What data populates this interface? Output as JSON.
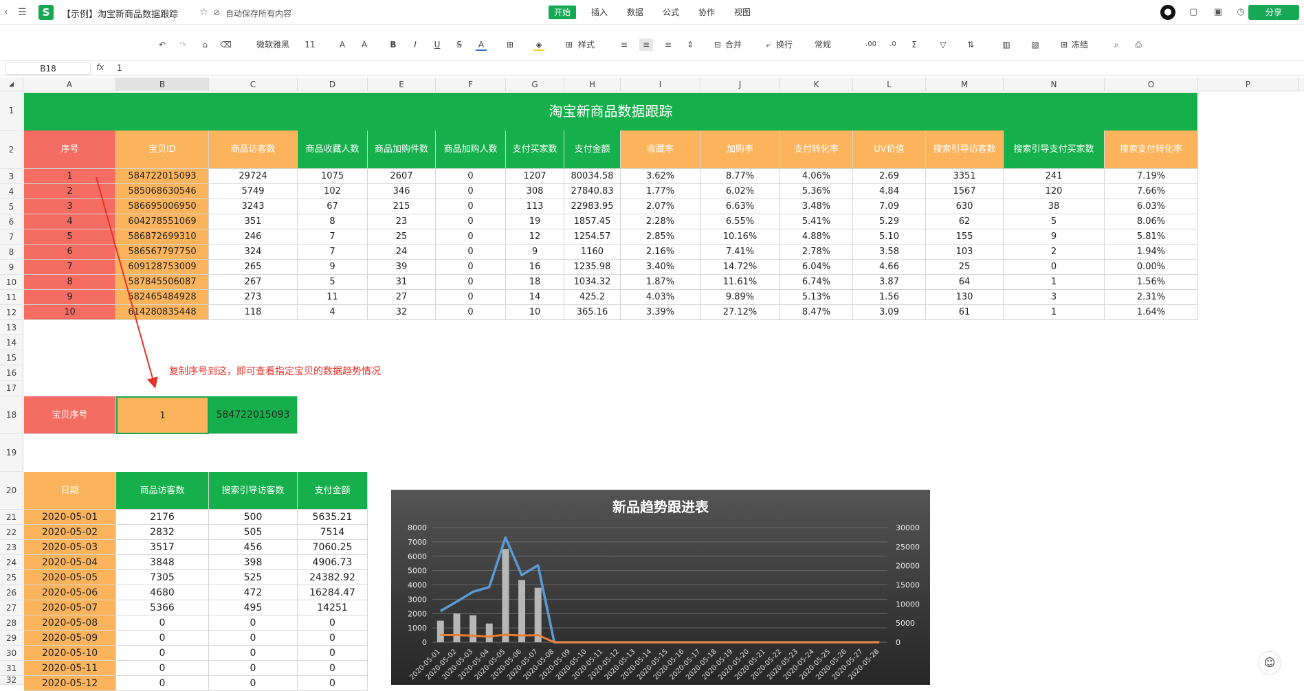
{
  "app": {
    "doc_title": "【示例】淘宝新商品数据跟踪",
    "autosave": "自动保存所有内容",
    "logo": "S",
    "menus": [
      "开始",
      "插入",
      "数据",
      "公式",
      "协作",
      "视图"
    ],
    "share": "分享"
  },
  "toolbar": {
    "font": "微软雅黑",
    "size": "11",
    "style_label": "样式",
    "merge_label": "合并",
    "wrap_label": "换行",
    "format_label": "常规",
    "dec_inc": ".00",
    "dec_dec": ".0",
    "freeze_label": "冻结"
  },
  "formula": {
    "cell_ref": "B18",
    "fx": "fx",
    "value": "1"
  },
  "columns": [
    "A",
    "B",
    "C",
    "D",
    "E",
    "F",
    "G",
    "H",
    "I",
    "J",
    "K",
    "L",
    "M",
    "N",
    "O",
    "P"
  ],
  "rows": [
    "1",
    "2",
    "3",
    "4",
    "5",
    "6",
    "7",
    "8",
    "9",
    "10",
    "11",
    "12",
    "13",
    "14",
    "15",
    "16",
    "17",
    "18",
    "19",
    "20",
    "21",
    "22",
    "23",
    "24",
    "25",
    "26",
    "27",
    "28",
    "29",
    "30",
    "31",
    "32"
  ],
  "sheet": {
    "title": "淘宝新商品数据跟踪",
    "headers": [
      "序号",
      "宝贝ID",
      "商品访客数",
      "商品收藏人数",
      "商品加购件数",
      "商品加购人数",
      "支付买家数",
      "支付金额",
      "收藏率",
      "加购率",
      "支付转化率",
      "UV价值",
      "搜索引导访客数",
      "搜索引导支付买家数",
      "搜索支付转化率"
    ],
    "data": [
      [
        "1",
        "584722015093",
        "29724",
        "1075",
        "2607",
        "0",
        "1207",
        "80034.58",
        "3.62%",
        "8.77%",
        "4.06%",
        "2.69",
        "3351",
        "241",
        "7.19%"
      ],
      [
        "2",
        "585068630546",
        "5749",
        "102",
        "346",
        "0",
        "308",
        "27840.83",
        "1.77%",
        "6.02%",
        "5.36%",
        "4.84",
        "1567",
        "120",
        "7.66%"
      ],
      [
        "3",
        "586695006950",
        "3243",
        "67",
        "215",
        "0",
        "113",
        "22983.95",
        "2.07%",
        "6.63%",
        "3.48%",
        "7.09",
        "630",
        "38",
        "6.03%"
      ],
      [
        "4",
        "604278551069",
        "351",
        "8",
        "23",
        "0",
        "19",
        "1857.45",
        "2.28%",
        "6.55%",
        "5.41%",
        "5.29",
        "62",
        "5",
        "8.06%"
      ],
      [
        "5",
        "586872699310",
        "246",
        "7",
        "25",
        "0",
        "12",
        "1254.57",
        "2.85%",
        "10.16%",
        "4.88%",
        "5.10",
        "155",
        "9",
        "5.81%"
      ],
      [
        "6",
        "586567797750",
        "324",
        "7",
        "24",
        "0",
        "9",
        "1160",
        "2.16%",
        "7.41%",
        "2.78%",
        "3.58",
        "103",
        "2",
        "1.94%"
      ],
      [
        "7",
        "609128753009",
        "265",
        "9",
        "39",
        "0",
        "16",
        "1235.98",
        "3.40%",
        "14.72%",
        "6.04%",
        "4.66",
        "25",
        "0",
        "0.00%"
      ],
      [
        "8",
        "587845506087",
        "267",
        "5",
        "31",
        "0",
        "18",
        "1034.32",
        "1.87%",
        "11.61%",
        "6.74%",
        "3.87",
        "64",
        "1",
        "1.56%"
      ],
      [
        "9",
        "582465484928",
        "273",
        "11",
        "27",
        "0",
        "14",
        "425.2",
        "4.03%",
        "9.89%",
        "5.13%",
        "1.56",
        "130",
        "3",
        "2.31%"
      ],
      [
        "10",
        "614280835448",
        "118",
        "4",
        "32",
        "0",
        "10",
        "365.16",
        "3.39%",
        "27.12%",
        "8.47%",
        "3.09",
        "61",
        "1",
        "1.64%"
      ]
    ],
    "annotation": "复制序号到这，即可查看指定宝贝的数据趋势情况",
    "lookup": {
      "label": "宝贝序号",
      "value": "1",
      "result": "584722015093"
    },
    "trend_headers": [
      "日期",
      "商品访客数",
      "搜索引导访客数",
      "支付金额"
    ],
    "trend_rows": [
      [
        "2020-05-01",
        "2176",
        "500",
        "5635.21"
      ],
      [
        "2020-05-02",
        "2832",
        "505",
        "7514"
      ],
      [
        "2020-05-03",
        "3517",
        "456",
        "7060.25"
      ],
      [
        "2020-05-04",
        "3848",
        "398",
        "4906.73"
      ],
      [
        "2020-05-05",
        "7305",
        "525",
        "24382.92"
      ],
      [
        "2020-05-06",
        "4680",
        "472",
        "16284.47"
      ],
      [
        "2020-05-07",
        "5366",
        "495",
        "14251"
      ],
      [
        "2020-05-08",
        "0",
        "0",
        "0"
      ],
      [
        "2020-05-09",
        "0",
        "0",
        "0"
      ],
      [
        "2020-05-10",
        "0",
        "0",
        "0"
      ],
      [
        "2020-05-11",
        "0",
        "0",
        "0"
      ],
      [
        "2020-05-12",
        "0",
        "0",
        "0"
      ]
    ]
  },
  "chart_data": {
    "type": "bar",
    "title": "新品趋势跟进表",
    "categories": [
      "2020-05-01",
      "2020-05-02",
      "2020-05-03",
      "2020-05-04",
      "2020-05-05",
      "2020-05-06",
      "2020-05-07",
      "2020-05-08",
      "2020-05-09",
      "2020-05-10",
      "2020-05-11",
      "2020-05-12",
      "2020-05-13",
      "2020-05-14",
      "2020-05-15",
      "2020-05-16",
      "2020-05-17",
      "2020-05-18",
      "2020-05-19",
      "2020-05-20",
      "2020-05-21",
      "2020-05-22",
      "2020-05-23",
      "2020-05-24",
      "2020-05-25",
      "2020-05-26",
      "2020-05-27",
      "2020-05-28"
    ],
    "series": [
      {
        "type": "bar",
        "axis": "right",
        "values": [
          5635.21,
          7514,
          7060.25,
          4906.73,
          24382.92,
          16284.47,
          14251,
          0,
          0,
          0,
          0,
          0,
          0,
          0,
          0,
          0,
          0,
          0,
          0,
          0,
          0,
          0,
          0,
          0,
          0,
          0,
          0,
          0
        ]
      },
      {
        "type": "line",
        "axis": "left",
        "color": "#5b9bd5",
        "values": [
          2176,
          2832,
          3517,
          3848,
          7305,
          4680,
          5366,
          0,
          0,
          0,
          0,
          0,
          0,
          0,
          0,
          0,
          0,
          0,
          0,
          0,
          0,
          0,
          0,
          0,
          0,
          0,
          0,
          0
        ]
      },
      {
        "type": "line",
        "axis": "left",
        "color": "#ed7d31",
        "values": [
          500,
          505,
          456,
          398,
          525,
          472,
          495,
          0,
          0,
          0,
          0,
          0,
          0,
          0,
          0,
          0,
          0,
          0,
          0,
          0,
          0,
          0,
          0,
          0,
          0,
          0,
          0,
          0
        ]
      }
    ],
    "ylim_left": [
      0,
      8000
    ],
    "ylim_right": [
      0,
      30000
    ],
    "left_ticks": [
      "8000",
      "7000",
      "6000",
      "5000",
      "4000",
      "3000",
      "2000",
      "1000",
      "0"
    ],
    "right_ticks": [
      "30000",
      "25000",
      "20000",
      "15000",
      "10000",
      "5000",
      "0"
    ],
    "grid": true
  }
}
